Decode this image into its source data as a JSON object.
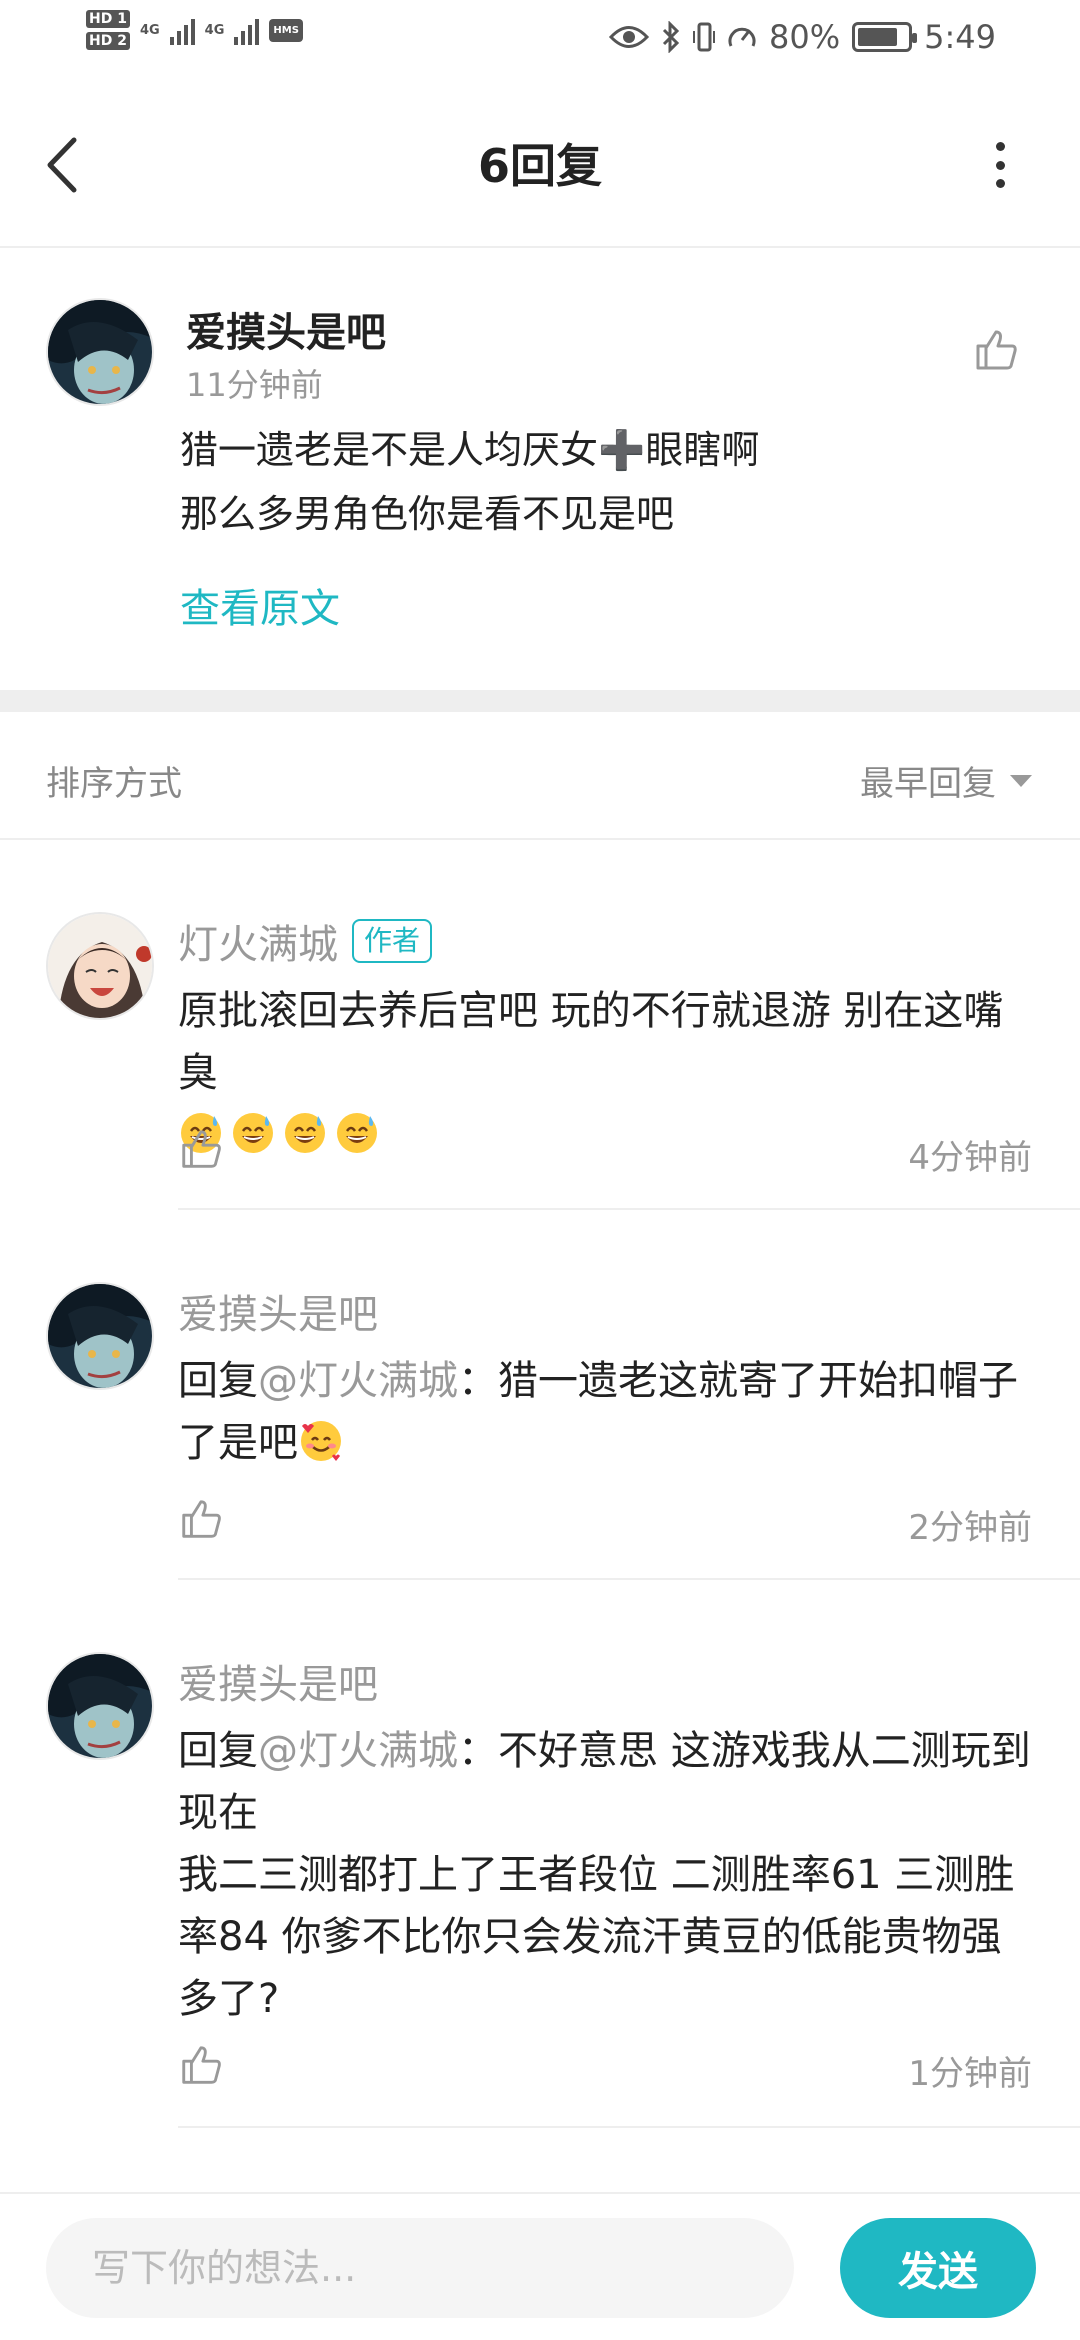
{
  "status_bar": {
    "sim1_label": "HD 1",
    "sim2_label": "HD 2",
    "network1": "4G",
    "network2": "4G",
    "hms_label": "HMS",
    "battery_percent": "80%",
    "battery_level": 0.8,
    "time": "5:49"
  },
  "header": {
    "title": "6回复",
    "back_icon": "chevron-left-icon",
    "more_icon": "more-vertical-icon"
  },
  "main_comment": {
    "username": "爱摸头是吧",
    "time": "11分钟前",
    "text": "猎一遗老是不是人均厌女➕眼瞎啊\n那么多男角色你是看不见是吧",
    "view_original": "查看原文"
  },
  "sort": {
    "label": "排序方式",
    "value": "最早回复"
  },
  "replies": [
    {
      "username": "灯火满城",
      "badge": "作者",
      "text": "原批滚回去养后宫吧  玩的不行就退游  别在这嘴臭",
      "emoji": "grinning-sweat-emoji",
      "emoji_count": 4,
      "time": "4分钟前"
    },
    {
      "username": "爱摸头是吧",
      "reply_prefix": "回复",
      "mention": "@灯火满城",
      "text": "：猎一遗老这就寄了开始扣帽子了是吧",
      "emoji": "smiling-hearts-emoji",
      "time": "2分钟前"
    },
    {
      "username": "爱摸头是吧",
      "reply_prefix": "回复",
      "mention": "@灯火满城",
      "text": "：不好意思 这游戏我从二测玩到现在",
      "text2": "我二三测都打上了王者段位 二测胜率61 三测胜率84 你爹不比你只会发流汗黄豆的低能贵物强多了?",
      "time": "1分钟前"
    }
  ],
  "composer": {
    "placeholder": "写下你的想法...",
    "send_label": "发送"
  },
  "colors": {
    "accent": "#1fb8c3",
    "text": "#222222",
    "muted": "#999999"
  }
}
